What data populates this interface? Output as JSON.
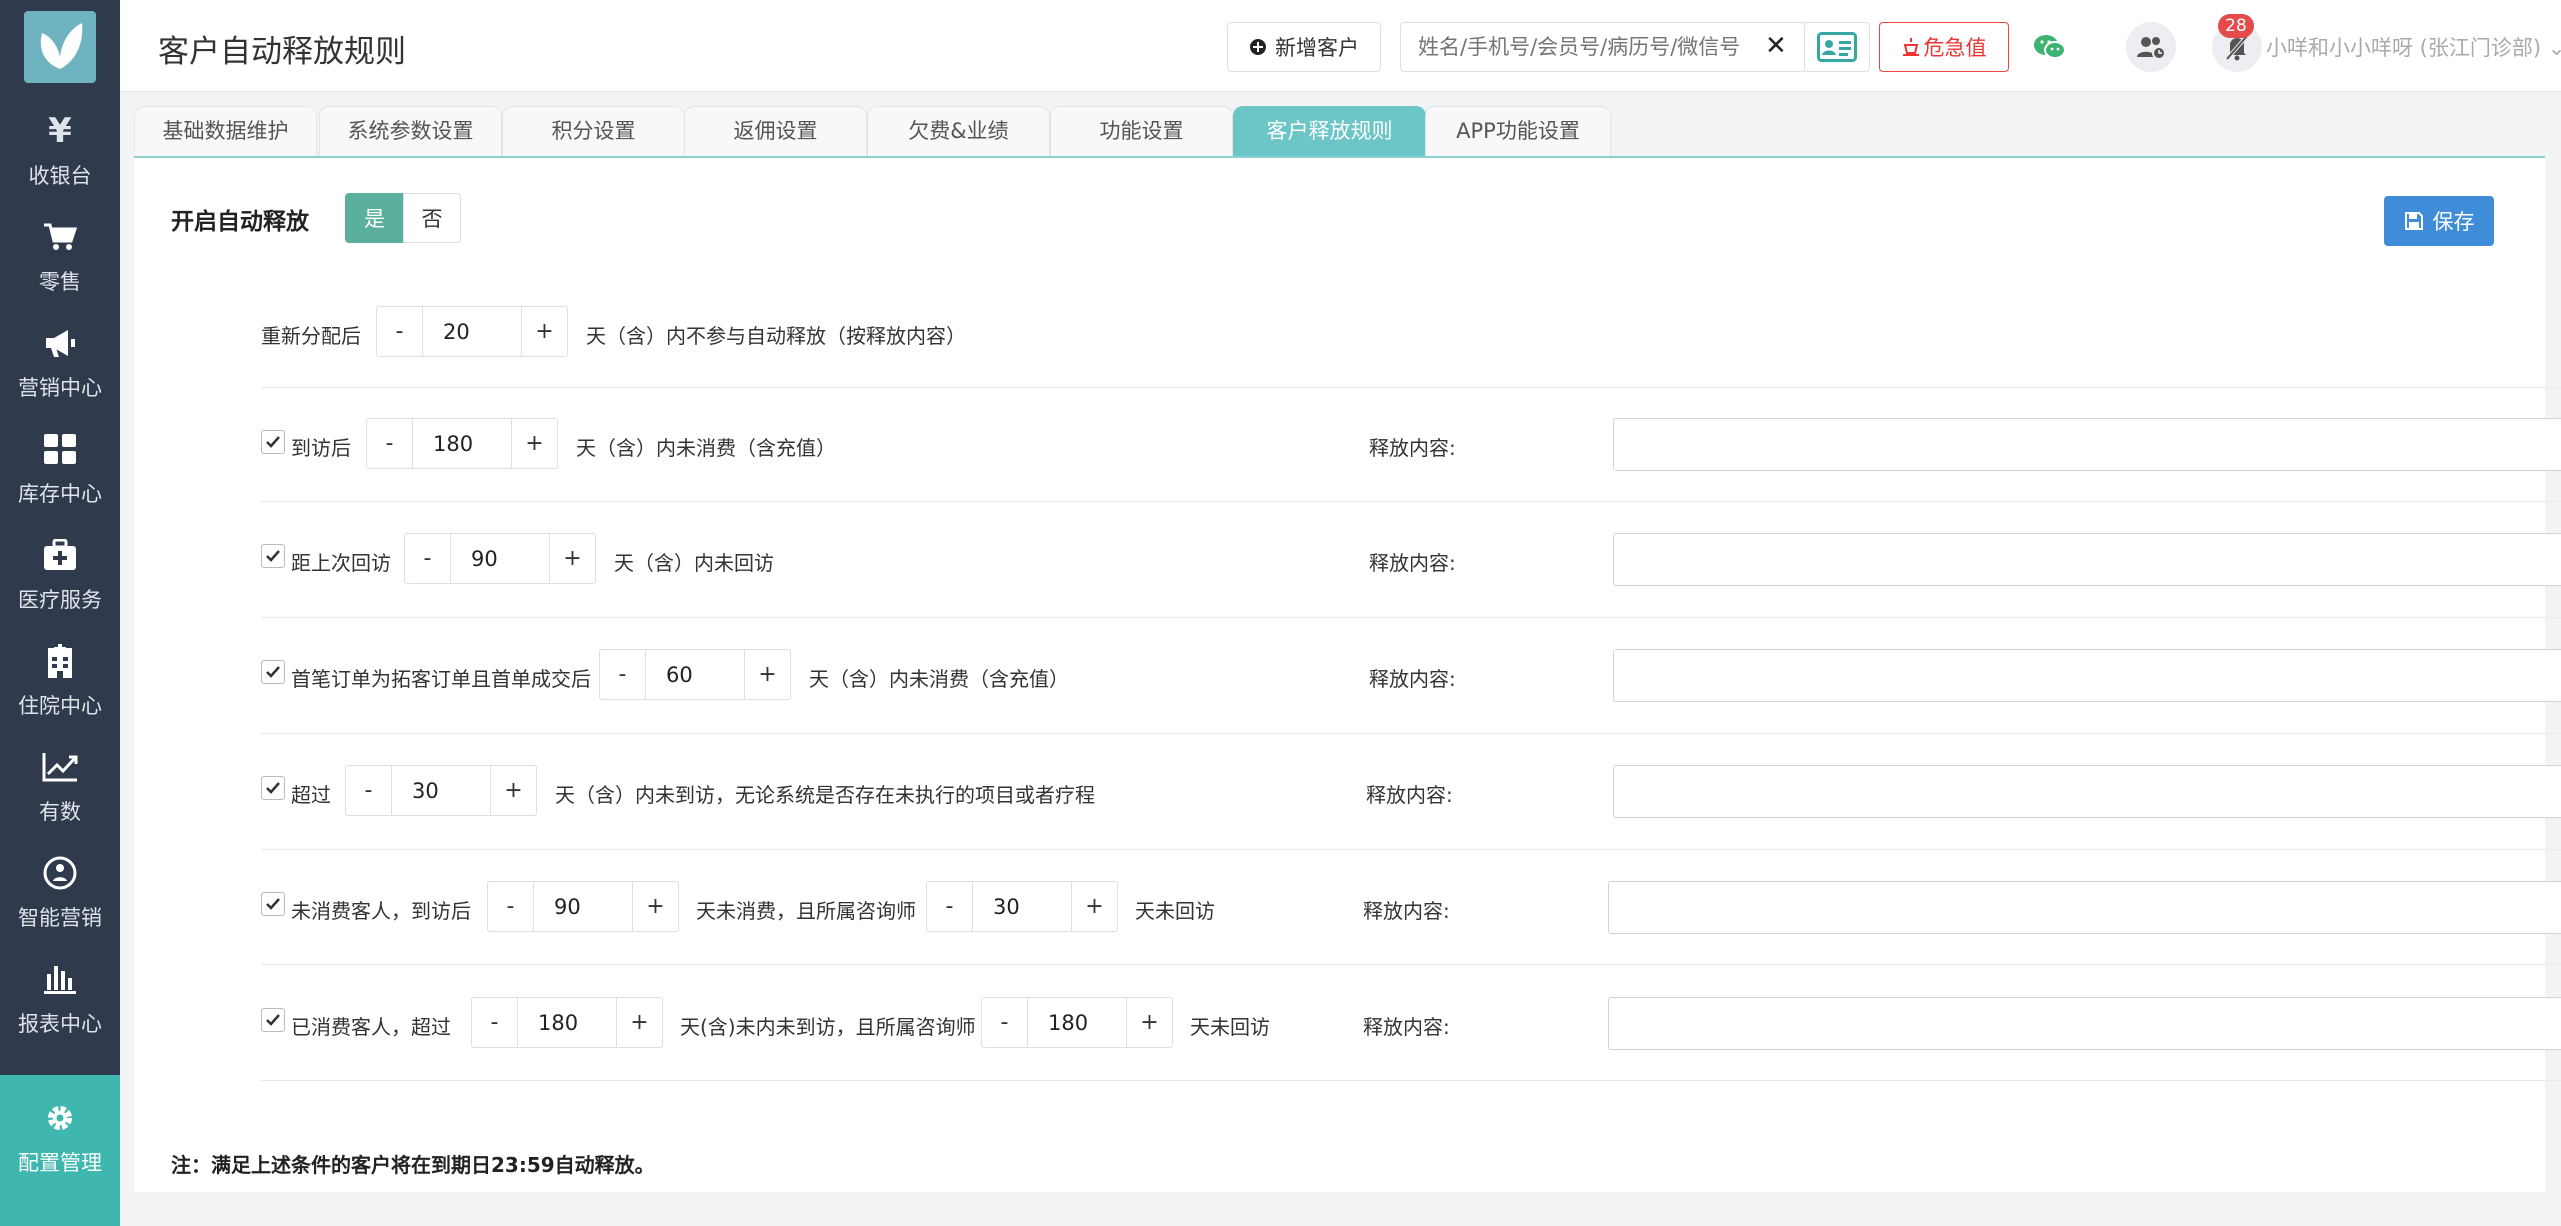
{
  "page_title": "客户自动释放规则",
  "sidebar": {
    "items": [
      {
        "label": "收银台",
        "icon": "yen-icon"
      },
      {
        "label": "零售",
        "icon": "cart-icon"
      },
      {
        "label": "营销中心",
        "icon": "megaphone-icon"
      },
      {
        "label": "库存中心",
        "icon": "grid-icon"
      },
      {
        "label": "医疗服务",
        "icon": "medkit-icon"
      },
      {
        "label": "住院中心",
        "icon": "hospital-icon"
      },
      {
        "label": "有数",
        "icon": "line-chart-icon"
      },
      {
        "label": "智能营销",
        "icon": "people-circle-icon"
      },
      {
        "label": "报表中心",
        "icon": "bar-chart-icon"
      },
      {
        "label": "配置管理",
        "icon": "gear-icon",
        "active": true
      }
    ]
  },
  "header": {
    "add_customer": "新增客户",
    "search_placeholder": "姓名/手机号/会员号/病历号/微信号",
    "danger_label": "危急值",
    "badge_count": "28",
    "user": "小咩和小小咩呀 (张江门诊部)"
  },
  "tabs": [
    "基础数据维护",
    "系统参数设置",
    "积分设置",
    "返佣设置",
    "欠费&业绩",
    "功能设置",
    "客户释放规则",
    "APP功能设置"
  ],
  "active_tab": "客户释放规则",
  "form": {
    "enable_label": "开启自动释放",
    "yes": "是",
    "no": "否",
    "enabled": true,
    "save_label": "保存",
    "reassign": {
      "prefix": "重新分配后",
      "value": "20",
      "suffix": "天（含）内不参与自动释放（按释放内容）"
    },
    "content_label": "释放内容:",
    "rules": [
      {
        "checked": true,
        "prefix": "到访后",
        "value": "180",
        "suffix": "天（含）内未消费（含充值）",
        "content": ""
      },
      {
        "checked": true,
        "prefix": "距上次回访",
        "value": "90",
        "suffix": "天（含）内未回访",
        "content": ""
      },
      {
        "checked": true,
        "prefix": "首笔订单为拓客订单且首单成交后",
        "value": "60",
        "suffix": "天（含）内未消费（含充值）",
        "content": ""
      },
      {
        "checked": true,
        "prefix": "超过",
        "value": "30",
        "suffix": "天（含）内未到访，无论系统是否存在未执行的项目或者疗程",
        "content": ""
      },
      {
        "checked": true,
        "prefix": "未消费客人，到访后",
        "value": "90",
        "middle": "天未消费，且所属咨询师",
        "value2": "30",
        "suffix": "天未回访",
        "content": ""
      },
      {
        "checked": true,
        "prefix": "已消费客人，超过",
        "value": "180",
        "middle": "天(含)未内未到访，且所属咨询师",
        "value2": "180",
        "suffix": "天未回访",
        "content": ""
      }
    ],
    "stepper_minus": "-",
    "stepper_plus": "+",
    "note": "注：满足上述条件的客户将在到期日23:59自动释放。"
  }
}
